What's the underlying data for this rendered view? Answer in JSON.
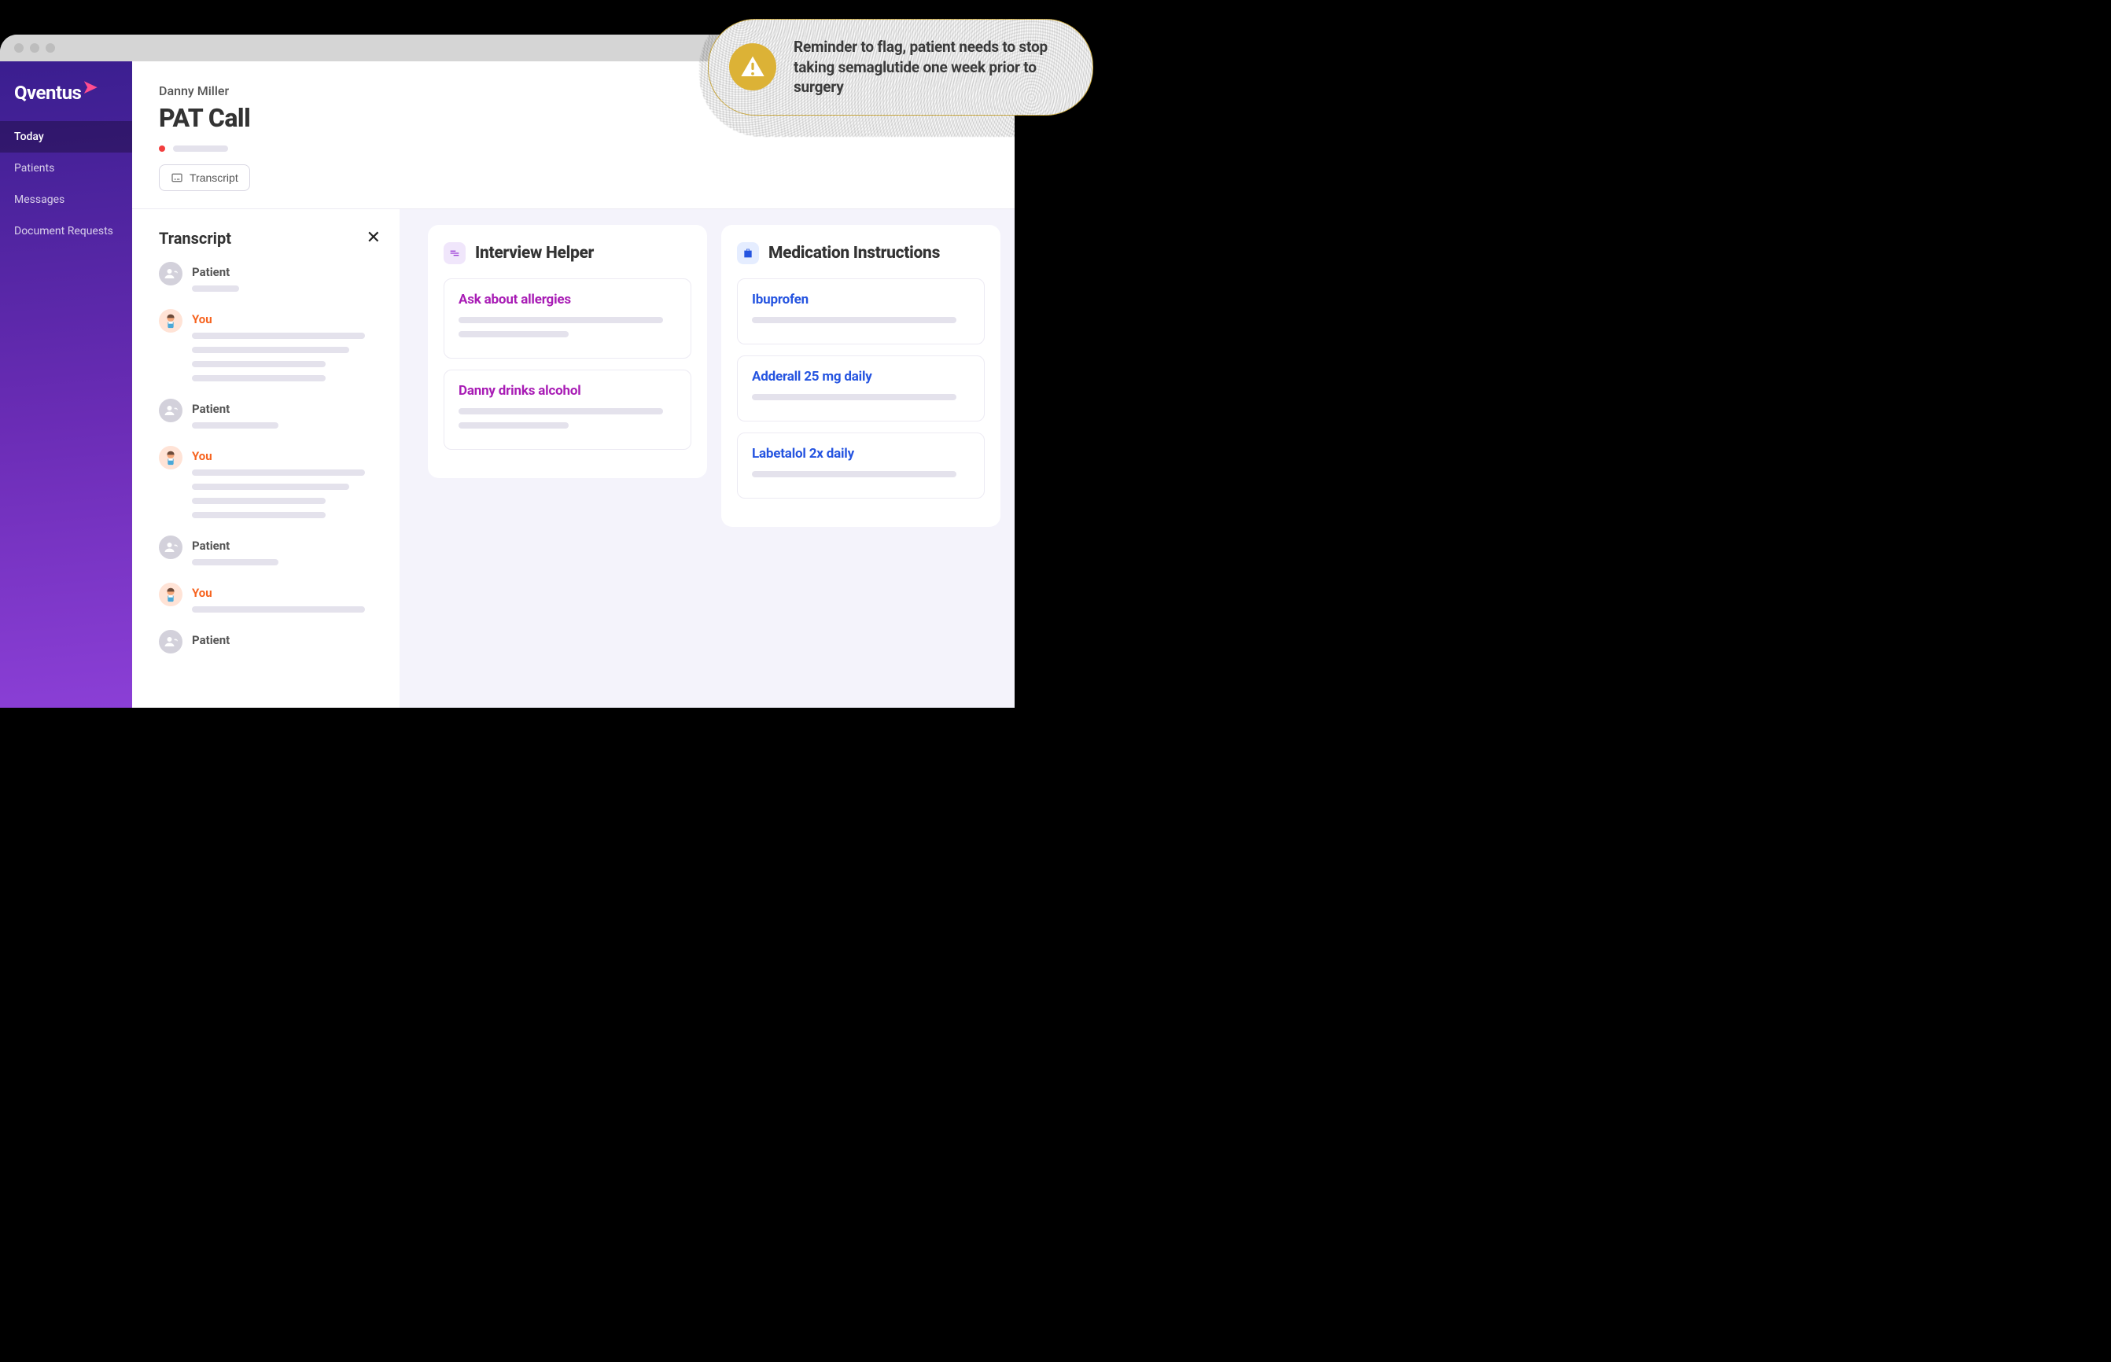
{
  "brand": "Qventus",
  "sidebar": {
    "items": [
      {
        "label": "Today",
        "active": true
      },
      {
        "label": "Patients",
        "active": false
      },
      {
        "label": "Messages",
        "active": false
      },
      {
        "label": "Document Requests",
        "active": false
      }
    ]
  },
  "header": {
    "patient_name": "Danny Miller",
    "page_title": "PAT Call",
    "transcript_button": "Transcript"
  },
  "transcript": {
    "title": "Transcript",
    "messages": [
      {
        "speaker": "Patient",
        "kind": "patient",
        "lines": [
          60
        ]
      },
      {
        "speaker": "You",
        "kind": "you",
        "lines": [
          220,
          200,
          170,
          170
        ]
      },
      {
        "speaker": "Patient",
        "kind": "patient",
        "lines": [
          110
        ]
      },
      {
        "speaker": "You",
        "kind": "you",
        "lines": [
          220,
          200,
          170,
          170
        ]
      },
      {
        "speaker": "Patient",
        "kind": "patient",
        "lines": [
          110
        ]
      },
      {
        "speaker": "You",
        "kind": "you",
        "lines": [
          220
        ]
      },
      {
        "speaker": "Patient",
        "kind": "patient",
        "lines": []
      }
    ]
  },
  "interview_helper": {
    "title": "Interview Helper",
    "items": [
      {
        "title": "Ask about allergies",
        "lines": [
          260,
          140
        ]
      },
      {
        "title": "Danny drinks alcohol",
        "lines": [
          260,
          140
        ]
      }
    ]
  },
  "medication_instructions": {
    "title": "Medication Instructions",
    "items": [
      {
        "title": "Ibuprofen",
        "lines": [
          260
        ]
      },
      {
        "title": "Adderall 25 mg daily",
        "lines": [
          260
        ]
      },
      {
        "title": "Labetalol 2x daily",
        "lines": [
          260
        ]
      }
    ]
  },
  "toast": {
    "text": "Reminder to flag, patient needs to stop taking semaglutide one week prior to surgery"
  }
}
